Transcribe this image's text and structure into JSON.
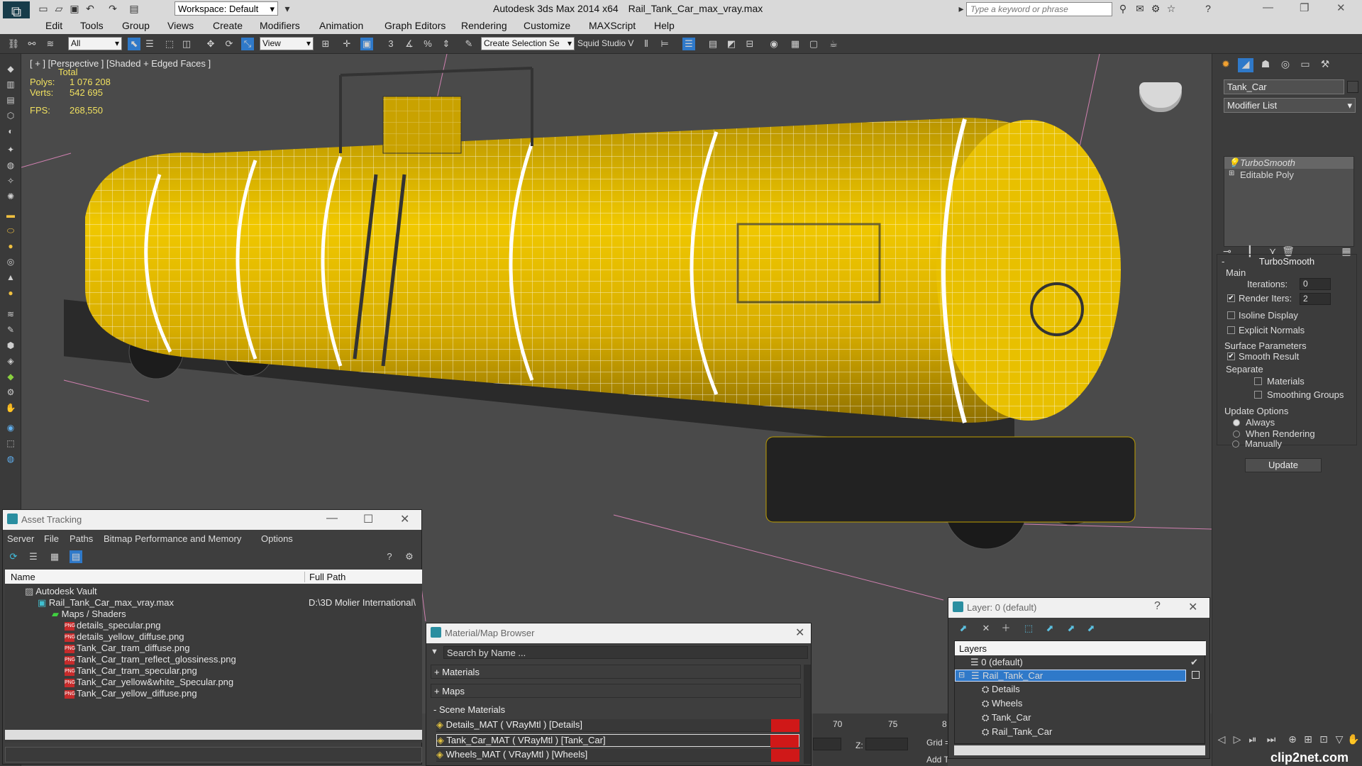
{
  "app": {
    "title": "Autodesk 3ds Max  2014 x64",
    "filename": "Rail_Tank_Car_max_vray.max",
    "workspace": "Workspace: Default",
    "search_placeholder": "Type a keyword or phrase"
  },
  "menu": [
    "Edit",
    "Tools",
    "Group",
    "Views",
    "Create",
    "Modifiers",
    "Animation",
    "Graph Editors",
    "Rendering",
    "Customize",
    "MAXScript",
    "Help"
  ],
  "toolbar": {
    "selection_filter": "All",
    "ref_coord": "View",
    "named_selection": "Create Selection Se",
    "studio_label": "Squid Studio V"
  },
  "viewport": {
    "label": "[ + ] [Perspective ] [Shaded + Edged Faces ]",
    "stats_header": "Total",
    "polys_label": "Polys:",
    "polys_value": "1 076 208",
    "verts_label": "Verts:",
    "verts_value": "542 695",
    "fps_label": "FPS:",
    "fps_value": "268,550"
  },
  "command_panel": {
    "object_name": "Tank_Car",
    "modifier_list": "Modifier List",
    "stack": [
      "TurboSmooth",
      "Editable Poly"
    ],
    "turbosmooth": {
      "title": "TurboSmooth",
      "main_label": "Main",
      "iterations_label": "Iterations:",
      "iterations_value": "0",
      "render_iters_label": "Render Iters:",
      "render_iters_value": "2",
      "isoline_label": "Isoline Display",
      "explicit_label": "Explicit Normals",
      "surface_label": "Surface Parameters",
      "smooth_label": "Smooth Result",
      "separate_label": "Separate",
      "materials_label": "Materials",
      "smoothing_label": "Smoothing Groups",
      "update_label": "Update Options",
      "always_label": "Always",
      "when_rendering_label": "When Rendering",
      "manually_label": "Manually",
      "update_button": "Update"
    }
  },
  "asset_tracking": {
    "title": "Asset Tracking",
    "menu": [
      "Server",
      "File",
      "Paths",
      "Bitmap Performance and Memory",
      "Options"
    ],
    "col_name": "Name",
    "col_path": "Full Path",
    "vault": "Autodesk Vault",
    "max_file": "Rail_Tank_Car_max_vray.max",
    "max_path": "D:\\3D Molier International\\",
    "maps_folder": "Maps / Shaders",
    "files": [
      "details_specular.png",
      "details_yellow_diffuse.png",
      "Tank_Car_tram_diffuse.png",
      "Tank_Car_tram_reflect_glossiness.png",
      "Tank_Car_tram_specular.png",
      "Tank_Car_yellow&white_Specular.png",
      "Tank_Car_yellow_diffuse.png"
    ]
  },
  "material_browser": {
    "title": "Material/Map Browser",
    "search_placeholder": "Search by Name ...",
    "materials": "+ Materials",
    "maps": "+ Maps",
    "scene_materials": "- Scene Materials",
    "items": [
      "Details_MAT  ( VRayMtl )  [Details]",
      "Tank_Car_MAT  ( VRayMtl )  [Tank_Car]",
      "Wheels_MAT  ( VRayMtl )  [Wheels]"
    ]
  },
  "layer_window": {
    "title": "Layer: 0 (default)",
    "help": "?",
    "col": "Layers",
    "default_layer": "0 (default)",
    "selected_layer": "Rail_Tank_Car",
    "children": [
      "Details",
      "Wheels",
      "Tank_Car",
      "Rail_Tank_Car"
    ]
  },
  "timeline": {
    "tick_70": "70",
    "tick_75": "75",
    "tick_8": "8",
    "z_label": "Z:",
    "grid_label": "Grid =",
    "add_label": "Add T"
  },
  "watermark": "clip2net.com",
  "colors": {
    "accent": "#2a8ea0",
    "selection": "#2f79c9",
    "tank_yellow": "#e0b800",
    "wire": "#ffffff",
    "swatch_red": "#d01818"
  }
}
